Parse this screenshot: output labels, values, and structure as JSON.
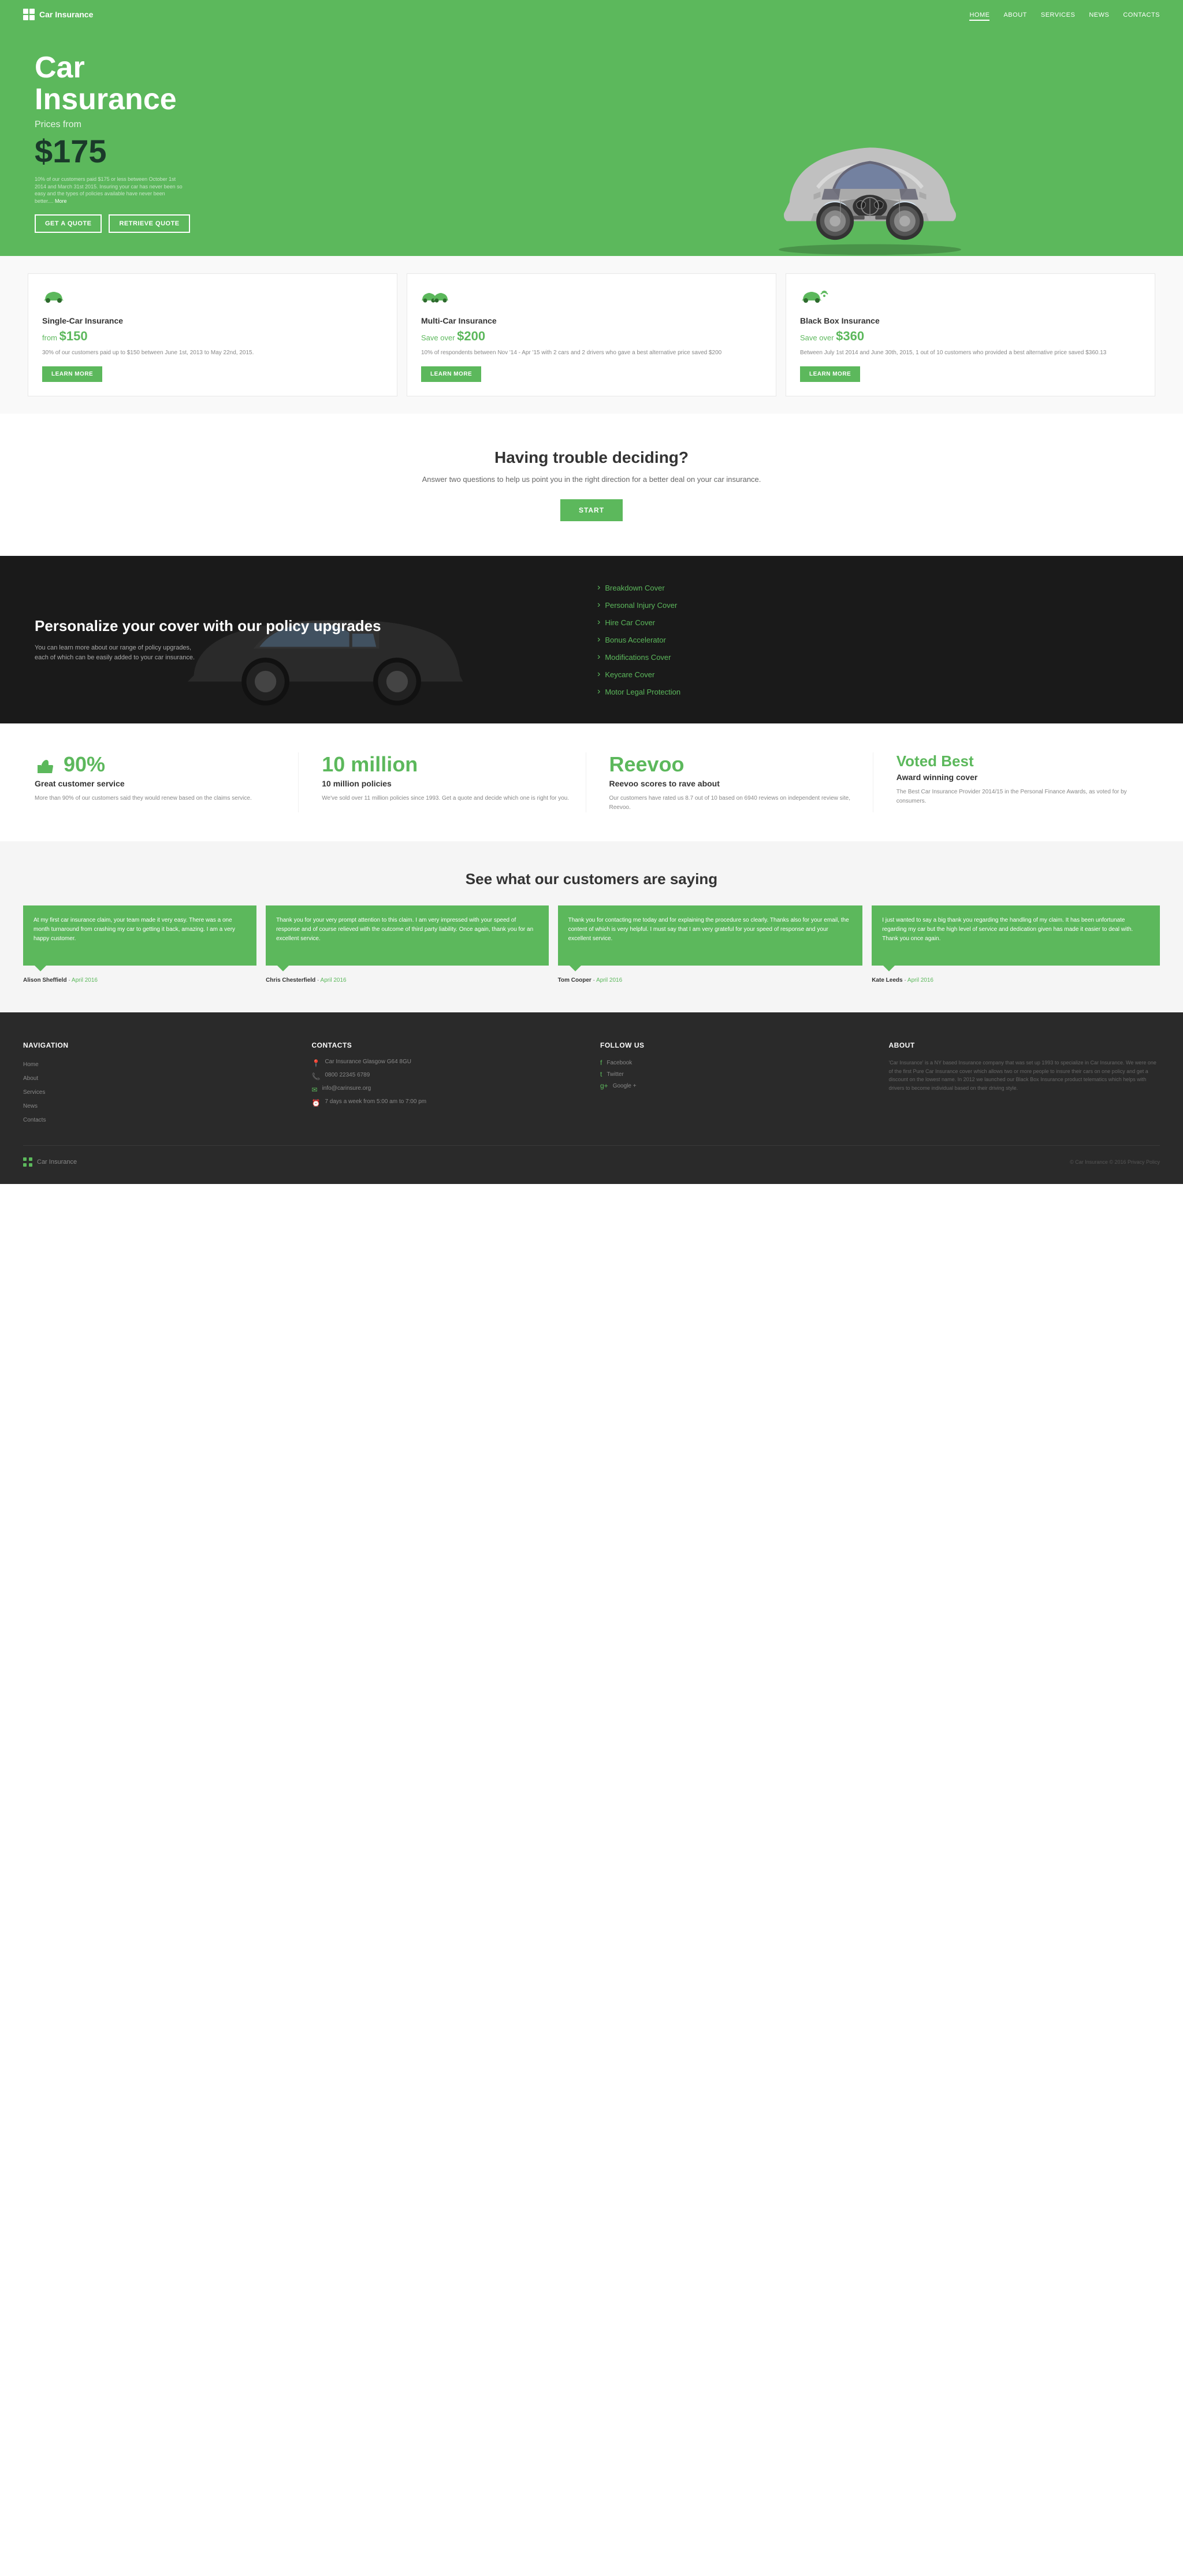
{
  "nav": {
    "logo": "Car Insurance",
    "links": [
      {
        "label": "HOME",
        "active": true
      },
      {
        "label": "ABOUT",
        "active": false
      },
      {
        "label": "SERVICES",
        "active": false
      },
      {
        "label": "NEWS",
        "active": false
      },
      {
        "label": "CONTACTS",
        "active": false
      }
    ]
  },
  "hero": {
    "title_line1": "Car",
    "title_line2": "Insurance",
    "price_from_label": "Prices from",
    "price": "$175",
    "disclaimer": "10% of our customers paid $175 or less between October 1st 2014 and March 31st 2015. Insuring your car has never been so easy and the types of policies available have never been better....",
    "more_link": "More",
    "btn_quote": "GET A QUOTE",
    "btn_retrieve": "RETRIEVE QUOTE"
  },
  "insurance_cards": [
    {
      "title": "Single-Car Insurance",
      "price_label": "from ",
      "price": "$150",
      "description": "30% of our customers paid up to $150 between June 1st, 2013 to May 22nd, 2015.",
      "btn": "LEARN MORE"
    },
    {
      "title": "Multi-Car Insurance",
      "price_label": "Save over ",
      "price": "$200",
      "description": "10% of respondents between Nov '14 - Apr '15 with 2 cars and 2 drivers who gave a best alternative price saved $200",
      "btn": "LEARN MORE"
    },
    {
      "title": "Black Box Insurance",
      "price_label": "Save over ",
      "price": "$360",
      "description": "Between July 1st 2014 and June 30th, 2015, 1 out of 10 customers who provided a best alternative price saved $360.13",
      "btn": "LEARN MORE"
    }
  ],
  "decide": {
    "title": "Having trouble deciding?",
    "description": "Answer two questions to help us point you in the right direction for a better deal on your car insurance.",
    "btn": "START"
  },
  "policy": {
    "title": "Personalize your cover with our policy upgrades",
    "description": "You can learn more about our range of policy upgrades, each of which can be easily added to your car insurance.",
    "items": [
      "Breakdown Cover",
      "Personal Injury Cover",
      "Hire Car Cover",
      "Bonus Accelerator",
      "Modifications Cover",
      "Keycare Cover",
      "Motor Legal Protection"
    ]
  },
  "stats": [
    {
      "number": "90%",
      "label": "Great customer service",
      "desc": "More than 90% of our customers said they would renew based on the claims service.",
      "icon": "thumbs-up"
    },
    {
      "number": "10 million",
      "label": "10 million policies",
      "desc": "We've sold over 11 million policies since 1993. Get a quote and decide which one is right for you.",
      "icon": "document"
    },
    {
      "number": "Reevoo",
      "label": "Reevoo scores to rave about",
      "desc": "Our customers have rated us 8.7 out of 10 based on 6940 reviews on independent review site, Reevoo.",
      "icon": "star"
    },
    {
      "number": "Voted Best",
      "label": "Award winning cover",
      "desc": "The Best Car Insurance Provider 2014/15 in the Personal Finance Awards, as voted for by consumers.",
      "icon": "trophy"
    }
  ],
  "testimonials": {
    "title": "See what our customers are saying",
    "items": [
      {
        "text": "At my first car insurance claim, your team made it very easy. There was a one month turnaround from crashing my car to getting it back, amazing. I am a very happy customer.",
        "author": "Alison Sheffield",
        "date": "April 2016"
      },
      {
        "text": "Thank you for your very prompt attention to this claim. I am very impressed with your speed of response and of course relieved with the outcome of third party liability. Once again, thank you for an excellent service.",
        "author": "Chris Chesterfield",
        "date": "April 2016"
      },
      {
        "text": "Thank you for contacting me today and for explaining the procedure so clearly. Thanks also for your email, the content of which is very helpful. I must say that I am very grateful for your speed of response and your excellent service.",
        "author": "Tom Cooper",
        "date": "April 2016"
      },
      {
        "text": "I just wanted to say a big thank you regarding the handling of my claim. It has been unfortunate regarding my car but the high level of service and dedication given has made it easier to deal with. Thank you once again.",
        "author": "Kate Leeds",
        "date": "April 2016"
      }
    ]
  },
  "footer": {
    "navigation": {
      "title": "Navigation",
      "links": [
        "Home",
        "About",
        "Services",
        "News",
        "Contacts"
      ]
    },
    "contacts": {
      "title": "Contacts",
      "address": "Car Insurance Glasgow G64 8GU",
      "phone": "0800 22345 6789",
      "email": "info@carinsure.org",
      "hours": "7 days a week from 5:00 am to 7:00 pm"
    },
    "social": {
      "title": "Follow Us",
      "links": [
        "Facebook",
        "Twitter",
        "Google +"
      ]
    },
    "about": {
      "title": "About",
      "text": "'Car Insurance' is a NY based Insurance company that was set up 1993 to specialize in Car Insurance. We were one of the first Pure Car Insurance cover which allows two or more people to insure their cars on one policy and get a discount on the lowest name. In 2012 we launched our Black Box Insurance product telematics which helps with drivers to become individual based on their driving style."
    },
    "copyright": "© Car Insurance © 2016  Privacy Policy"
  }
}
